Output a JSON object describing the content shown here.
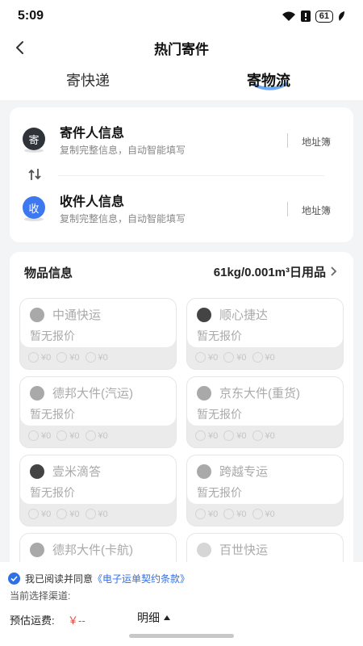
{
  "status_bar": {
    "time": "5:09",
    "battery": "61"
  },
  "nav": {
    "title": "热门寄件"
  },
  "tabs": [
    {
      "label": "寄快递",
      "active": false
    },
    {
      "label": "寄物流",
      "active": true
    }
  ],
  "sender": {
    "avatar_text": "寄",
    "title": "寄件人信息",
    "subtitle": "复制完整信息，自动智能填写",
    "address_book": "地址簿"
  },
  "receiver": {
    "avatar_text": "收",
    "title": "收件人信息",
    "subtitle": "复制完整信息，自动智能填写",
    "address_book": "地址簿"
  },
  "goods": {
    "label": "物品信息",
    "value": "61kg/0.001m³日用品"
  },
  "carriers": [
    {
      "name": "中通快运",
      "quote": "暂无报价",
      "prices": [
        "¥0",
        "¥0",
        "¥0"
      ]
    },
    {
      "name": "顺心捷达",
      "quote": "暂无报价",
      "prices": [
        "¥0",
        "¥0",
        "¥0"
      ]
    },
    {
      "name": "德邦大件(汽运)",
      "quote": "暂无报价",
      "prices": [
        "¥0",
        "¥0",
        "¥0"
      ]
    },
    {
      "name": "京东大件(重货)",
      "quote": "暂无报价",
      "prices": [
        "¥0",
        "¥0",
        "¥0"
      ]
    },
    {
      "name": "壹米滴答",
      "quote": "暂无报价",
      "prices": [
        "¥0",
        "¥0",
        "¥0"
      ]
    },
    {
      "name": "跨越专运",
      "quote": "暂无报价",
      "prices": [
        "¥0",
        "¥0",
        "¥0"
      ]
    },
    {
      "name": "德邦大件(卡航)"
    },
    {
      "name": "百世快运"
    }
  ],
  "footer": {
    "agree_prefix": "我已阅读并同意",
    "agree_link": "《电子运单契约条款》",
    "channel_label": "当前选择渠道:",
    "fee_label": "预估运费:",
    "fee_value": "￥--",
    "detail_label": "明细"
  },
  "colors": {
    "accent": "#2f6fe8",
    "price_red": "#e04a3c",
    "avatar_dark": "#2f343b",
    "avatar_blue": "#3e78f0"
  }
}
